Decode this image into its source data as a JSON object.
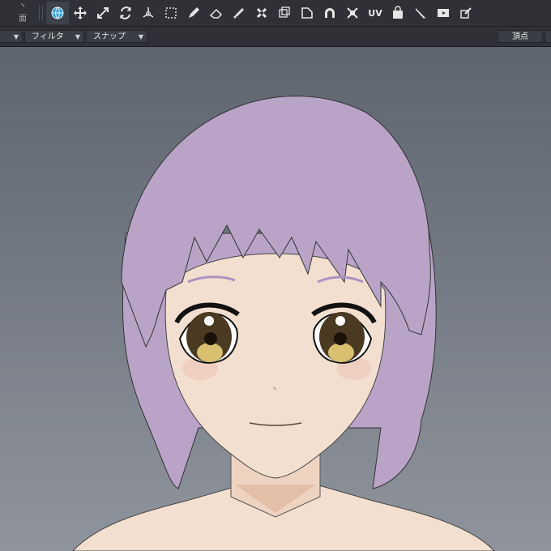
{
  "toolbar": {
    "left_stub": {
      "label_top": "ヽ",
      "label_face": "面"
    },
    "tools": [
      {
        "name": "globe-icon",
        "active": true
      },
      {
        "name": "move-icon"
      },
      {
        "name": "scale-icon"
      },
      {
        "name": "rotate-icon"
      },
      {
        "name": "transform-icon"
      },
      {
        "name": "marquee-select-icon"
      },
      {
        "name": "pen-icon"
      },
      {
        "name": "eraser-icon"
      },
      {
        "name": "brush-icon"
      },
      {
        "name": "weld-icon"
      },
      {
        "name": "box-icon"
      },
      {
        "name": "bevel-icon"
      },
      {
        "name": "arch-icon"
      },
      {
        "name": "collapse-icon"
      },
      {
        "name": "uv-icon",
        "text": "UV"
      },
      {
        "name": "bag-icon"
      },
      {
        "name": "knife-icon"
      },
      {
        "name": "video-icon"
      },
      {
        "name": "edit-icon"
      }
    ]
  },
  "subbar": {
    "filter_label": "フィルタ",
    "snap_label": "スナップ",
    "vertex_label": "頂点"
  },
  "viewport": {
    "hair_color": "#b9a4c8",
    "skin_color": "#f3dfd0",
    "iris_color": "#4a3a22",
    "highlight_color": "#d8c070"
  }
}
